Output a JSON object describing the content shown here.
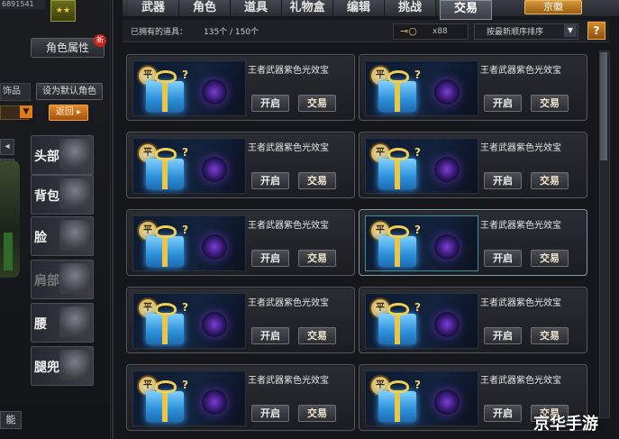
{
  "left": {
    "player_id": "6891541",
    "rank": "★★",
    "role_attr_label": "角色属性",
    "new_tag": "新",
    "small_tab": "饰品",
    "set_default_label": "设为默认角色",
    "back_label": "返回 ▸",
    "nav_arrows": [
      "◂",
      "↩"
    ],
    "slots": [
      {
        "label": "头部",
        "dim": false
      },
      {
        "label": "背包",
        "dim": false
      },
      {
        "label": "脸",
        "dim": false
      },
      {
        "label": "肩部",
        "dim": true
      },
      {
        "label": "腰",
        "dim": false
      },
      {
        "label": "腿兜",
        "dim": false
      }
    ],
    "func_label": "能"
  },
  "tabs": [
    {
      "label": "武器",
      "active": false
    },
    {
      "label": "角色",
      "active": false
    },
    {
      "label": "道具",
      "active": false
    },
    {
      "label": "礼物盒",
      "active": false
    },
    {
      "label": "编辑",
      "active": false
    },
    {
      "label": "挑战",
      "active": false
    },
    {
      "label": "交易",
      "active": true
    }
  ],
  "top_right_btn": "京徽",
  "info": {
    "owned_label": "已拥有的道具：",
    "owned_count": "135个 / 150个",
    "key_count": "x88",
    "sort_label": "按最新顺序排序",
    "help": "?"
  },
  "items": [
    {
      "name": "王者武器紫色光效宝",
      "open": "开启",
      "trade": "交易",
      "selected": false
    },
    {
      "name": "王者武器紫色光效宝",
      "open": "开启",
      "trade": "交易",
      "selected": false
    },
    {
      "name": "王者武器紫色光效宝",
      "open": "开启",
      "trade": "交易",
      "selected": false
    },
    {
      "name": "王者武器紫色光效宝",
      "open": "开启",
      "trade": "交易",
      "selected": false
    },
    {
      "name": "王者武器紫色光效宝",
      "open": "开启",
      "trade": "交易",
      "selected": false
    },
    {
      "name": "王者武器紫色光效宝",
      "open": "开启",
      "trade": "交易",
      "selected": true
    },
    {
      "name": "王者武器紫色光效宝",
      "open": "开启",
      "trade": "交易",
      "selected": false
    },
    {
      "name": "王者武器紫色光效宝",
      "open": "开启",
      "trade": "交易",
      "selected": false
    },
    {
      "name": "王者武器紫色光效宝",
      "open": "开启",
      "trade": "交易",
      "selected": false
    },
    {
      "name": "王者武器紫色光效宝",
      "open": "开启",
      "trade": "交易",
      "selected": false
    }
  ],
  "icons": {
    "seal": "平",
    "qmark": "?",
    "key": "⊸○",
    "sort_arrow": "▼"
  },
  "watermark": "京华手游"
}
